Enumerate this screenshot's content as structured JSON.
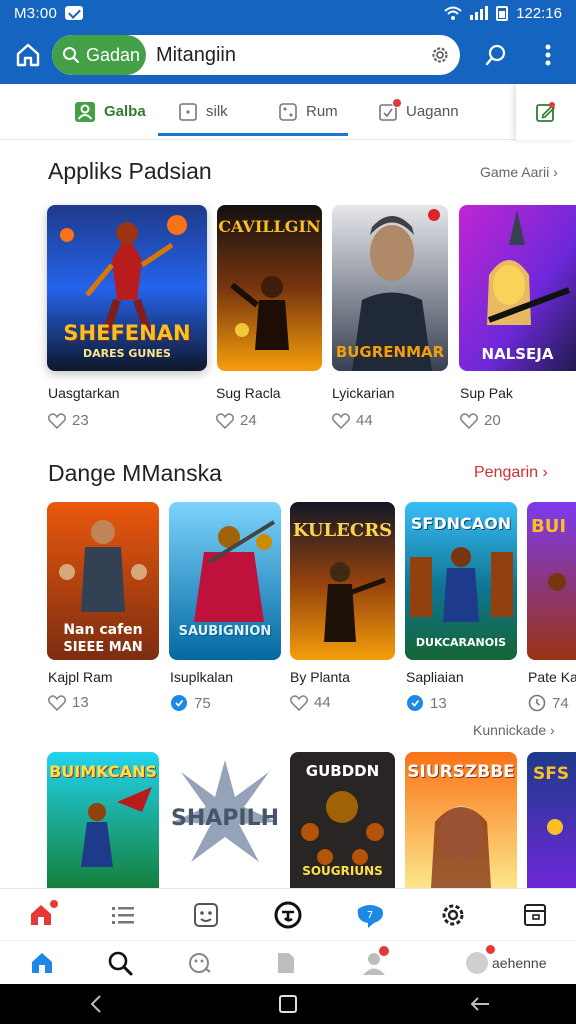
{
  "status_bar": {
    "time": "M3:00",
    "clock": "122:16"
  },
  "search": {
    "chip_label": "Gadan",
    "value": "Mitangiin"
  },
  "tabs": [
    {
      "label": "Galba"
    },
    {
      "label": "silk"
    },
    {
      "label": "Rum"
    },
    {
      "label": "Uagann"
    }
  ],
  "section1": {
    "title": "Appliks Padsian",
    "link": "Game Aarii",
    "cards": [
      {
        "title": "Uasgtarkan",
        "likes": "23",
        "art_top": "",
        "art_bottom": "SHEFENAN",
        "art_sub": "DARES GUNES"
      },
      {
        "title": "Sug Racla",
        "likes": "24",
        "art_top": "CAVILLGIN",
        "art_bottom": "",
        "art_sub": ""
      },
      {
        "title": "Lyickarian",
        "likes": "44",
        "art_top": "",
        "art_bottom": "BUGRENMAR",
        "art_sub": ""
      },
      {
        "title": "Sup Pak",
        "likes": "20",
        "art_top": "",
        "art_bottom": "NALSEJA",
        "art_sub": ""
      }
    ]
  },
  "section2": {
    "title": "Dange MManska",
    "link": "Pengarin",
    "cards": [
      {
        "title": "Kajpl Ram",
        "likes": "13",
        "art_top": "",
        "art_bottom": "Nan cafen",
        "art_sub": "SIEEE MAN"
      },
      {
        "title": "Isuplkalan",
        "likes": "75",
        "art_top": "",
        "art_bottom": "SAUBIGNION",
        "art_sub": ""
      },
      {
        "title": "By Planta",
        "likes": "44",
        "art_top": "KULECRS",
        "art_bottom": "",
        "art_sub": ""
      },
      {
        "title": "Sapliaian",
        "likes": "13",
        "art_top": "SFDNCAON",
        "art_bottom": "DUKCARANOIS",
        "art_sub": ""
      },
      {
        "title": "Pate Kal",
        "likes": "74",
        "art_top": "BUI",
        "art_bottom": "",
        "art_sub": ""
      }
    ],
    "more_link": "Kunnickade"
  },
  "section3": {
    "cards": [
      {
        "art_top": "BUIMKCANS",
        "art_bottom": ""
      },
      {
        "art_top": "",
        "art_bottom": "SHAPILH"
      },
      {
        "art_top": "GUBDDN",
        "art_bottom": "SOUGRIUNS"
      },
      {
        "art_top": "SIURSZBBE",
        "art_bottom": ""
      },
      {
        "art_top": "SFS",
        "art_bottom": ""
      }
    ]
  },
  "bottom_bar": {
    "profile_label": "aehenne",
    "badge_count": "7"
  },
  "colors": {
    "primary": "#1565c0",
    "accent_green": "#43a047",
    "accent_red": "#d32f2f",
    "tab_underline": "#1976d2"
  }
}
